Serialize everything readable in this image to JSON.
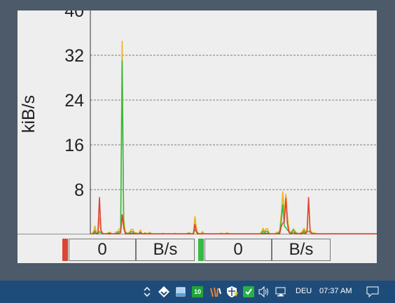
{
  "chart_data": {
    "type": "line",
    "ylabel": "kiB/s",
    "yticks": [
      8,
      16,
      24,
      32,
      40
    ],
    "ylim": [
      0,
      40
    ],
    "grid": true,
    "series": [
      {
        "color": "#f0b020",
        "values": [
          0,
          0.2,
          0.4,
          1.5,
          0.3,
          0.1,
          3.0,
          0.5,
          0.2,
          0.1,
          0.1,
          0.2,
          0.3,
          0.4,
          0.1,
          0.1,
          0.1,
          0.5,
          0.5,
          1.0,
          1.0,
          34.5,
          3.0,
          0.5,
          0.3,
          0.2,
          0.5,
          0.9,
          0.9,
          0.3,
          0.3,
          0.2,
          0.2,
          0.8,
          0.2,
          0.1,
          0.3,
          0.2,
          0.1,
          0.4,
          0.2,
          0.1,
          0.1,
          0.1,
          0.1,
          0.1,
          0.1,
          0.1,
          0.2,
          0.1,
          0.1,
          0.1,
          0.1,
          0.1,
          0.1,
          0.1,
          0.2,
          0.1,
          0.1,
          0.1,
          0.1,
          0.1,
          0.1,
          0.1,
          0.2,
          0.3,
          0.2,
          0.1,
          0.3,
          3.2,
          1.0,
          0.3,
          0.1,
          0.2,
          0.5,
          0.1,
          0.1,
          0.1,
          0.1,
          0.1,
          0.1,
          0.1,
          0.1,
          0.1,
          0.1,
          0.1,
          0.2,
          0.2,
          0.1,
          0.1,
          0.3,
          0.2,
          0.1,
          0.1,
          0.1,
          0.1,
          0.1,
          0.1,
          0.1,
          0.1,
          0.1,
          0.1,
          0.1,
          0.1,
          0.1,
          0.1,
          0.1,
          0.1,
          0.1,
          0.1,
          0.1,
          0.1,
          0.1,
          0.5,
          1.1,
          0.5,
          1.0,
          1.0,
          0.2,
          0.1,
          0.1,
          0.1,
          0.1,
          0.4,
          0.3,
          0.8,
          3.8,
          7.6,
          3.5,
          7.2,
          3.5,
          0.8,
          0.3,
          0.6,
          1.0,
          0.6,
          0.3,
          0.2,
          0.2,
          0.3,
          0.6,
          1.1,
          0.4,
          1.0,
          6.2,
          0.8,
          0.4,
          0.2,
          0.3,
          0.1,
          0.1,
          0.1,
          0.1,
          0.1,
          0.1,
          0.1,
          0.1,
          0.1,
          0.1,
          0.1,
          0.1,
          0.1,
          0.1,
          0.1,
          0.1,
          0.1,
          0.1,
          0.1,
          0.1,
          0.1,
          0.1,
          0.1,
          0.1,
          0.1,
          0.1,
          0.1,
          0.1,
          0.1,
          0.1,
          0.1,
          0.1,
          0.1,
          0.1,
          0.1,
          0.1,
          0.1,
          0.1,
          0.1,
          0.1,
          0.1
        ]
      },
      {
        "color": "#33bb44",
        "values": [
          0,
          0.1,
          0.2,
          0.7,
          0.2,
          0.1,
          0.5,
          0.3,
          0.1,
          0.1,
          0.1,
          0.1,
          0.2,
          0.2,
          0.1,
          0.1,
          0.1,
          0.2,
          0.3,
          0.5,
          0.6,
          31.0,
          1.5,
          0.3,
          0.2,
          0.1,
          0.3,
          0.5,
          0.5,
          0.2,
          0.2,
          0.1,
          0.1,
          0.4,
          0.1,
          0.1,
          0.2,
          0.1,
          0.1,
          0.2,
          0.1,
          0.1,
          0.1,
          0.1,
          0.1,
          0.1,
          0.1,
          0.1,
          0.1,
          0.1,
          0.1,
          0.1,
          0.1,
          0.1,
          0.1,
          0.1,
          0.1,
          0.1,
          0.1,
          0.1,
          0.1,
          0.1,
          0.1,
          0.1,
          0.1,
          0.2,
          0.1,
          0.1,
          0.2,
          0.8,
          0.5,
          0.2,
          0.1,
          0.1,
          0.2,
          0.1,
          0.1,
          0.1,
          0.1,
          0.1,
          0.1,
          0.1,
          0.1,
          0.1,
          0.1,
          0.1,
          0.1,
          0.1,
          0.1,
          0.1,
          0.1,
          0.1,
          0.1,
          0.1,
          0.1,
          0.1,
          0.1,
          0.1,
          0.1,
          0.1,
          0.1,
          0.1,
          0.1,
          0.1,
          0.1,
          0.1,
          0.1,
          0.1,
          0.1,
          0.1,
          0.1,
          0.1,
          0.1,
          0.2,
          0.6,
          0.3,
          0.6,
          0.5,
          0.1,
          0.1,
          0.1,
          0.1,
          0.1,
          0.2,
          0.2,
          0.5,
          2.5,
          5.3,
          1.5,
          1.2,
          0.8,
          0.5,
          0.2,
          0.4,
          0.8,
          0.4,
          0.2,
          0.1,
          0.1,
          0.2,
          0.3,
          0.7,
          0.2,
          0.5,
          0.5,
          0.4,
          0.2,
          0.1,
          0.1,
          0.1,
          0.1,
          0.1,
          0.1,
          0.1,
          0.1,
          0.1,
          0.1,
          0.1,
          0.1,
          0.1,
          0.1,
          0.1,
          0.1,
          0.1,
          0.1,
          0.1,
          0.1,
          0.1,
          0.1,
          0.1,
          0.1,
          0.1,
          0.1,
          0.1,
          0.1,
          0.1,
          0.1,
          0.1,
          0.1,
          0.1,
          0.1,
          0.1,
          0.1,
          0.1,
          0.1,
          0.1,
          0.1,
          0.1,
          0.1,
          0.1
        ]
      },
      {
        "color": "#dd4433",
        "values": [
          0,
          0,
          0.1,
          0.3,
          0.2,
          0.1,
          6.6,
          0.8,
          0.2,
          0.1,
          0.1,
          0.1,
          0.1,
          0.2,
          0.1,
          0.1,
          0.1,
          0.1,
          0.1,
          0.2,
          0.3,
          3.5,
          1.2,
          0.2,
          0.1,
          0.1,
          0.1,
          0.2,
          0.2,
          0.1,
          0.1,
          0.1,
          0.1,
          0.3,
          0.1,
          0.1,
          0.1,
          0.1,
          0.1,
          0.1,
          0.1,
          0.1,
          0.1,
          0.1,
          0.1,
          0.1,
          0.1,
          0.1,
          0.1,
          0.1,
          0.1,
          0.1,
          0.1,
          0.1,
          0.1,
          0.1,
          0.1,
          0.1,
          0.1,
          0.1,
          0.1,
          0.1,
          0.1,
          0.1,
          0.1,
          0.1,
          0.1,
          0.1,
          0.1,
          1.8,
          0.4,
          0.1,
          0.1,
          0.1,
          0.1,
          0.1,
          0.1,
          0.1,
          0.1,
          0.1,
          0.1,
          0.1,
          0.1,
          0.1,
          0.1,
          0.1,
          0.1,
          0.1,
          0.1,
          0.1,
          0.1,
          0.1,
          0.1,
          0.1,
          0.1,
          0.1,
          0.1,
          0.1,
          0.1,
          0.1,
          0.1,
          0.1,
          0.1,
          0.1,
          0.1,
          0.1,
          0.1,
          0.1,
          0.1,
          0.1,
          0.1,
          0.1,
          0.1,
          0.1,
          0.2,
          0.1,
          0.2,
          0.2,
          0.1,
          0.1,
          0.1,
          0.1,
          0.1,
          0.1,
          0.1,
          0.2,
          1.5,
          2.0,
          2.3,
          6.5,
          2.0,
          0.4,
          0.1,
          0.2,
          0.3,
          0.2,
          0.1,
          0.1,
          0.1,
          0.1,
          0.2,
          0.3,
          0.1,
          0.5,
          6.6,
          0.5,
          0.2,
          0.1,
          0.1,
          0.1,
          0.1,
          0.1,
          0.1,
          0.1,
          0.1,
          0.1,
          0.1,
          0.1,
          0.1,
          0.1,
          0.1,
          0.1,
          0.1,
          0.1,
          0.1,
          0.1,
          0.1,
          0.1,
          0.1,
          0.1,
          0.1,
          0.1,
          0.1,
          0.1,
          0.1,
          0.1,
          0.1,
          0.1,
          0.1,
          0.1,
          0.1,
          0.1,
          0.1,
          0.1,
          0.1,
          0.1,
          0.1,
          0.1,
          0.1,
          0.1
        ]
      }
    ]
  },
  "readouts": [
    {
      "value": "0",
      "unit": "B/s",
      "color": "#dd4433"
    },
    {
      "value": "0",
      "unit": "B/s",
      "color": "#33bb44"
    }
  ],
  "taskbar": {
    "icons": [
      "show-hidden-icons-icon",
      "app-tray-icon",
      "storage-icon",
      "app-10-icon",
      "app-tray-icon-2",
      "security-warning-icon",
      "checked-shield-icon",
      "volume-icon",
      "network-icon"
    ],
    "app_badge": "10",
    "language": "DEU",
    "time": "07:37 AM"
  }
}
